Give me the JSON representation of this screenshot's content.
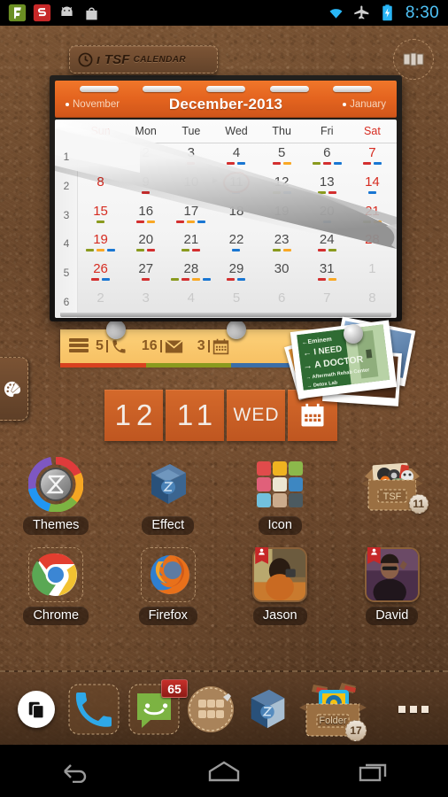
{
  "statusbar": {
    "time": "8:30",
    "left_icons": [
      "foursquare-icon",
      "s-app-icon",
      "android-icon",
      "play-store-icon"
    ],
    "right_icons": [
      "wifi-icon",
      "airplane-mode-icon",
      "battery-charging-icon"
    ],
    "clock_color": "#4fc3f7"
  },
  "widget_title": {
    "refresh_icon": "refresh-icon",
    "brand": "ı TSF",
    "suffix": "CALENDAR"
  },
  "page_badge": {
    "icon": "page-indicator-icon"
  },
  "calendar": {
    "prev_month": "November",
    "next_month": "January",
    "title": "December-2013",
    "accent": "#e4641f",
    "weekday_headers": [
      "Sun",
      "Mon",
      "Tue",
      "Wed",
      "Thu",
      "Fri",
      "Sat"
    ],
    "today": 11,
    "week_numbers": [
      "1",
      "2",
      "3",
      "4",
      "5",
      "6"
    ],
    "weeks": [
      [
        {
          "n": "1",
          "out": true,
          "marks": []
        },
        {
          "n": "2",
          "out": false,
          "marks": []
        },
        {
          "n": "3",
          "out": false,
          "marks": [
            "#d32f2f"
          ]
        },
        {
          "n": "4",
          "out": false,
          "marks": [
            "#d32f2f",
            "#1976d2"
          ]
        },
        {
          "n": "5",
          "out": false,
          "marks": [
            "#d32f2f",
            "#f9a825"
          ]
        },
        {
          "n": "6",
          "out": false,
          "marks": [
            "#8a9a1e",
            "#d32f2f",
            "#1976d2"
          ]
        },
        {
          "n": "7",
          "out": false,
          "marks": [
            "#d32f2f",
            "#1976d2"
          ]
        }
      ],
      [
        {
          "n": "8",
          "out": false,
          "marks": []
        },
        {
          "n": "9",
          "out": false,
          "marks": [
            "#d32f2f"
          ]
        },
        {
          "n": "10",
          "out": false,
          "marks": []
        },
        {
          "n": "11",
          "out": false,
          "marks": [
            "#1976d2"
          ]
        },
        {
          "n": "12",
          "out": false,
          "marks": [
            "#8a9a1e",
            "#1976d2"
          ]
        },
        {
          "n": "13",
          "out": false,
          "marks": [
            "#8a9a1e",
            "#d32f2f"
          ]
        },
        {
          "n": "14",
          "out": false,
          "marks": [
            "#1976d2"
          ]
        }
      ],
      [
        {
          "n": "15",
          "out": false,
          "marks": [
            "#8a9a1e"
          ]
        },
        {
          "n": "16",
          "out": false,
          "marks": [
            "#d32f2f",
            "#f9a825"
          ]
        },
        {
          "n": "17",
          "out": false,
          "marks": [
            "#d32f2f",
            "#f9a825",
            "#1976d2"
          ]
        },
        {
          "n": "18",
          "out": false,
          "marks": []
        },
        {
          "n": "19",
          "out": false,
          "marks": []
        },
        {
          "n": "20",
          "out": false,
          "marks": [
            "#1976d2"
          ]
        },
        {
          "n": "21",
          "out": false,
          "marks": [
            "#8a9a1e",
            "#f9a825"
          ]
        }
      ],
      [
        {
          "n": "19",
          "out": false,
          "marks": [
            "#8a9a1e",
            "#f9a825",
            "#1976d2"
          ]
        },
        {
          "n": "20",
          "out": false,
          "marks": [
            "#8a9a1e",
            "#d32f2f"
          ]
        },
        {
          "n": "21",
          "out": false,
          "marks": [
            "#8a9a1e",
            "#d32f2f"
          ]
        },
        {
          "n": "22",
          "out": false,
          "marks": [
            "#1976d2"
          ]
        },
        {
          "n": "23",
          "out": false,
          "marks": [
            "#8a9a1e",
            "#f9a825"
          ]
        },
        {
          "n": "24",
          "out": false,
          "marks": [
            "#d32f2f",
            "#8a9a1e"
          ]
        },
        {
          "n": "28",
          "out": false,
          "marks": []
        }
      ],
      [
        {
          "n": "26",
          "out": false,
          "marks": [
            "#d32f2f",
            "#1976d2"
          ]
        },
        {
          "n": "27",
          "out": false,
          "marks": [
            "#d32f2f"
          ]
        },
        {
          "n": "28",
          "out": false,
          "marks": [
            "#8a9a1e",
            "#d32f2f",
            "#f9a825",
            "#1976d2"
          ]
        },
        {
          "n": "29",
          "out": false,
          "marks": [
            "#d32f2f",
            "#1976d2"
          ]
        },
        {
          "n": "30",
          "out": false,
          "marks": []
        },
        {
          "n": "31",
          "out": false,
          "marks": [
            "#d32f2f",
            "#f9a825"
          ]
        },
        {
          "n": "1",
          "out": true,
          "marks": []
        }
      ],
      [
        {
          "n": "2",
          "out": true,
          "marks": []
        },
        {
          "n": "3",
          "out": true,
          "marks": []
        },
        {
          "n": "4",
          "out": true,
          "marks": []
        },
        {
          "n": "5",
          "out": true,
          "marks": []
        },
        {
          "n": "6",
          "out": true,
          "marks": []
        },
        {
          "n": "7",
          "out": true,
          "marks": []
        },
        {
          "n": "8",
          "out": true,
          "marks": []
        }
      ]
    ]
  },
  "sticky": {
    "stack_icon": "stack-icon",
    "items": [
      {
        "count": "5",
        "icon": "phone-icon",
        "stripe": "#d8411f"
      },
      {
        "count": "16",
        "icon": "envelope-icon",
        "stripe": "#8a9a1e"
      },
      {
        "count": "3",
        "icon": "calendar-icon",
        "stripe": "#3b6ea8"
      }
    ]
  },
  "photo_widget": {
    "name": "photo-stack-widget",
    "sign_lines": [
      "←Eminem",
      "← I NEED",
      "→ A DOCTOR",
      "→ Aftermath Rehab Center",
      "→ Detox Lab"
    ]
  },
  "date_widget": {
    "month": "12",
    "day": "11",
    "weekday": "WED",
    "icon": "calendar-icon",
    "tile_color": "#c95f25"
  },
  "left_tab": {
    "icon": "paint-palette-icon"
  },
  "app_rows": [
    [
      {
        "label": "Themes",
        "icon": "themes-icon"
      },
      {
        "label": "Effect",
        "icon": "effect-cube-icon"
      },
      {
        "label": "Icon",
        "icon": "icon-grid-icon"
      },
      {
        "label": "TSF",
        "icon": "folder-box-icon",
        "badge": "11",
        "is_folder": true
      }
    ],
    [
      {
        "label": "Chrome",
        "icon": "chrome-icon"
      },
      {
        "label": "Firefox",
        "icon": "firefox-icon"
      },
      {
        "label": "Jason",
        "icon": "contact-photo-icon",
        "is_contact": true
      },
      {
        "label": "David",
        "icon": "contact-photo-icon",
        "is_contact": true
      }
    ]
  ],
  "dock": {
    "recent_icon": "recent-apps-icon",
    "items": [
      {
        "name": "phone",
        "icon": "phone-icon"
      },
      {
        "name": "messaging",
        "icon": "sms-icon",
        "badge": "65"
      },
      {
        "name": "app-drawer",
        "icon": "app-drawer-icon"
      },
      {
        "name": "effect",
        "icon": "effect-cube-icon"
      },
      {
        "name": "folder",
        "icon": "folder-box-icon",
        "label": "Folder",
        "badge": "17"
      }
    ],
    "overflow_icon": "overflow-dots-icon"
  },
  "navbar": {
    "back_icon": "back-icon",
    "home_icon": "home-icon",
    "recents_icon": "recents-icon"
  }
}
